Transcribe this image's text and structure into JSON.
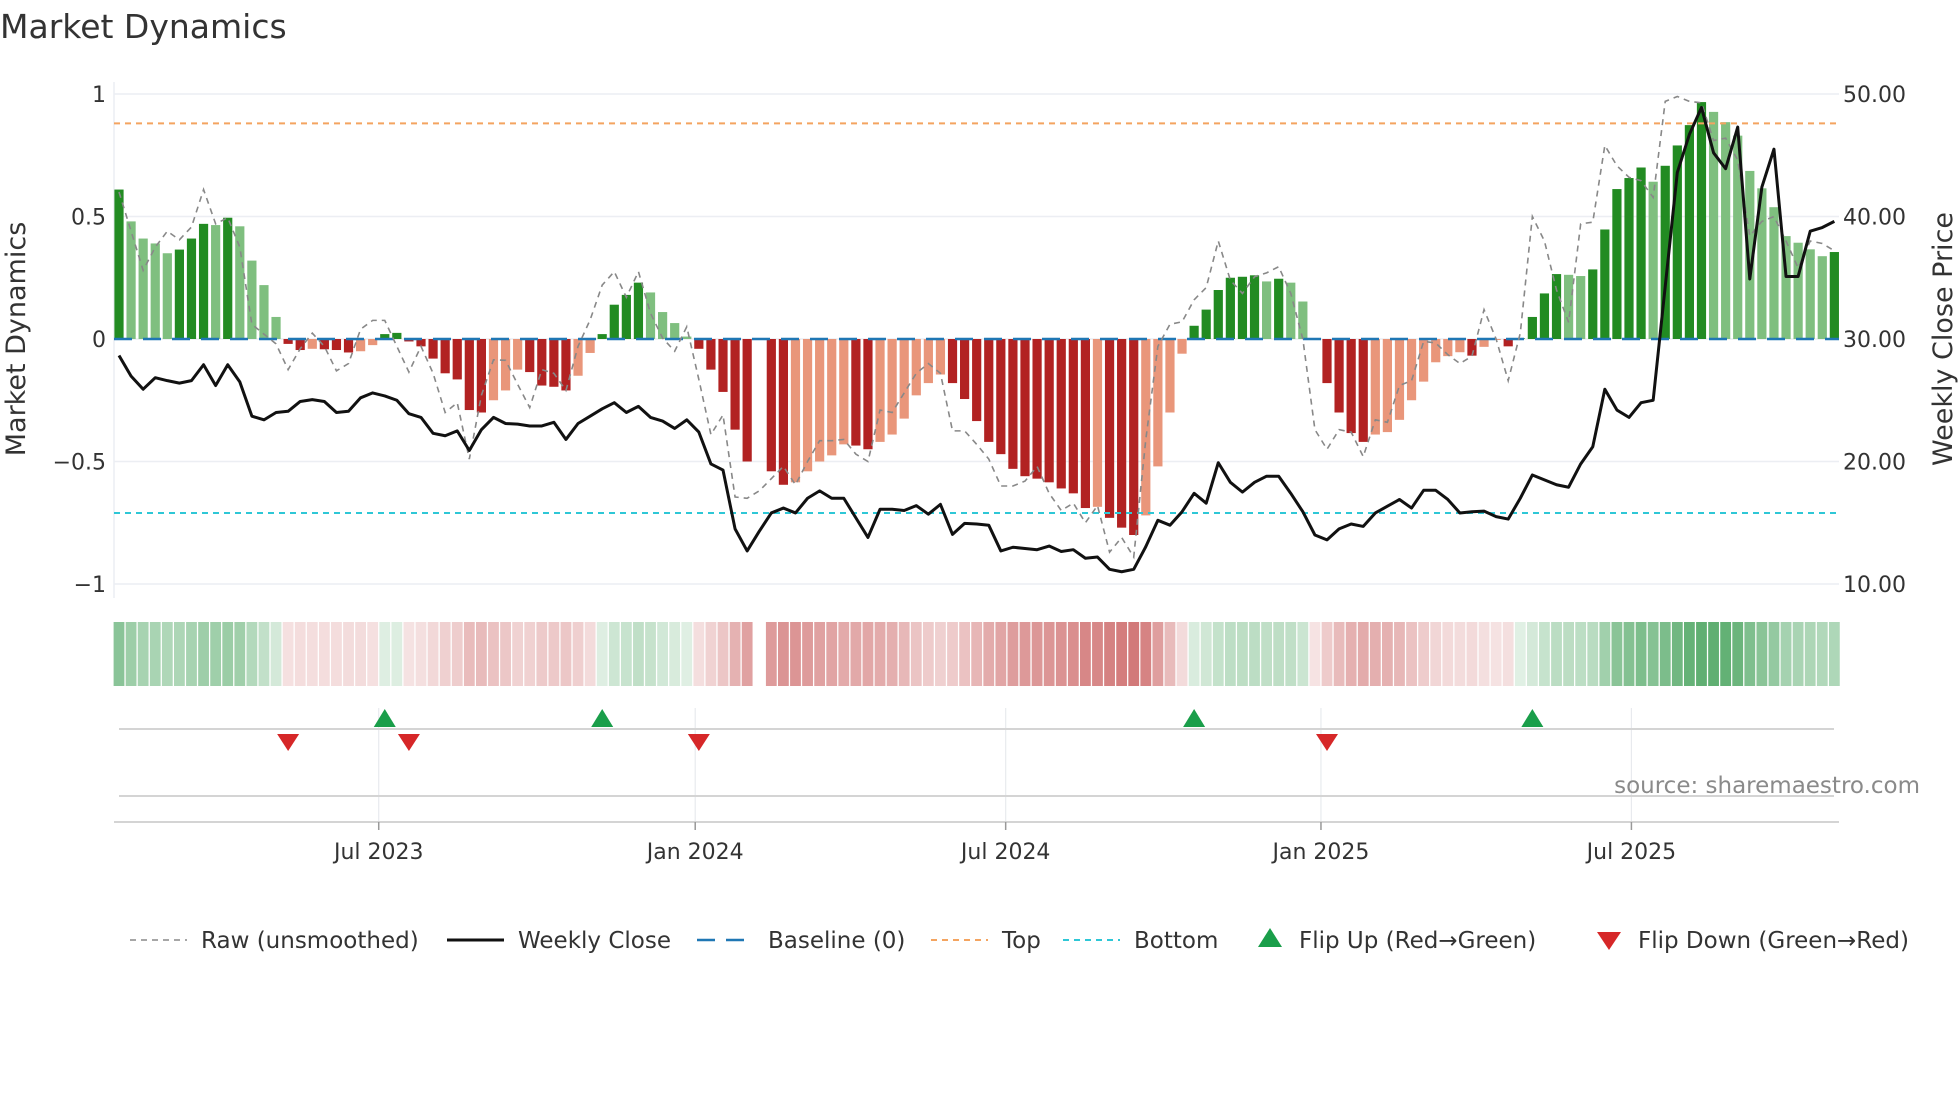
{
  "chart_data": {
    "type": "bar",
    "title": "Market Dynamics",
    "ylabel_left": "Market Dynamics",
    "ylabel_right": "Weekly Close Price",
    "ylim_left": [
      -1,
      1
    ],
    "ylim_right": [
      10,
      50
    ],
    "yticks_left": [
      "1",
      "0.5",
      "0",
      "−0.5",
      "−1"
    ],
    "yticks_left_values": [
      1,
      0.5,
      0,
      -0.5,
      -1
    ],
    "yticks_right": [
      "50.00",
      "40.00",
      "30.00",
      "20.00",
      "10.00"
    ],
    "yticks_right_values": [
      50,
      40,
      30,
      20,
      10
    ],
    "xticks": [
      {
        "label": "Jul 2023",
        "week_index": 21.5
      },
      {
        "label": "Jan 2024",
        "week_index": 47.7
      },
      {
        "label": "Jul 2024",
        "week_index": 73.4
      },
      {
        "label": "Jan 2025",
        "week_index": 99.5
      },
      {
        "label": "Jul 2025",
        "week_index": 125.2
      }
    ],
    "top_level": 0.88,
    "bottom_level": -0.71,
    "baseline": 0,
    "grid": true,
    "smoothed": [
      0.61,
      0.48,
      0.41,
      0.39,
      0.35,
      0.365,
      0.41,
      0.47,
      0.465,
      0.495,
      0.46,
      0.32,
      0.22,
      0.09,
      -0.02,
      -0.045,
      -0.04,
      -0.042,
      -0.045,
      -0.055,
      -0.05,
      -0.025,
      0.02,
      0.025,
      -0.01,
      -0.03,
      -0.08,
      -0.14,
      -0.165,
      -0.29,
      -0.3,
      -0.25,
      -0.21,
      -0.125,
      -0.135,
      -0.19,
      -0.195,
      -0.21,
      -0.15,
      -0.057,
      0.02,
      0.14,
      0.18,
      0.23,
      0.19,
      0.11,
      0.065,
      0.01,
      -0.04,
      -0.125,
      -0.216,
      -0.37,
      -0.5,
      null,
      -0.54,
      -0.595,
      -0.585,
      -0.54,
      -0.5,
      -0.475,
      -0.43,
      -0.435,
      -0.45,
      -0.42,
      -0.39,
      -0.325,
      -0.23,
      -0.18,
      -0.145,
      -0.18,
      -0.245,
      -0.335,
      -0.42,
      -0.47,
      -0.53,
      -0.56,
      -0.57,
      -0.585,
      -0.61,
      -0.63,
      -0.69,
      -0.685,
      -0.73,
      -0.77,
      -0.8,
      -0.72,
      -0.52,
      -0.3,
      -0.06,
      0.054,
      0.12,
      0.2,
      0.25,
      0.254,
      0.26,
      0.235,
      0.246,
      0.23,
      0.153,
      -0.003,
      -0.18,
      -0.3,
      -0.384,
      -0.42,
      -0.39,
      -0.38,
      -0.33,
      -0.25,
      -0.174,
      -0.095,
      -0.07,
      -0.054,
      -0.068,
      -0.032,
      -0.004,
      -0.03,
      0.003,
      0.09,
      0.186,
      0.265,
      0.262,
      0.257,
      0.284,
      0.447,
      0.612,
      0.657,
      0.7,
      0.642,
      0.707,
      0.79,
      0.873,
      0.967,
      0.927,
      0.885,
      0.83,
      0.686,
      0.615,
      0.538,
      0.42,
      0.393,
      0.366,
      0.338,
      0.355
    ],
    "raw": [
      0.6,
      0.44,
      0.28,
      0.375,
      0.44,
      0.405,
      0.457,
      0.61,
      0.47,
      0.495,
      0.375,
      0.06,
      0.02,
      -0.02,
      -0.125,
      -0.04,
      0.024,
      -0.03,
      -0.13,
      -0.1,
      0.04,
      0.076,
      0.076,
      -0.03,
      -0.135,
      -0.03,
      -0.14,
      -0.3,
      -0.26,
      -0.49,
      -0.23,
      -0.085,
      -0.087,
      -0.185,
      -0.28,
      -0.125,
      -0.14,
      -0.21,
      -0.03,
      0.078,
      0.22,
      0.275,
      0.17,
      0.275,
      0.105,
      0.004,
      -0.05,
      0.05,
      -0.165,
      -0.39,
      -0.31,
      -0.645,
      -0.65,
      -0.62,
      -0.57,
      -0.52,
      -0.595,
      -0.5,
      -0.415,
      -0.415,
      -0.41,
      -0.47,
      -0.5,
      -0.29,
      -0.3,
      -0.22,
      -0.14,
      -0.1,
      -0.14,
      -0.375,
      -0.375,
      -0.43,
      -0.49,
      -0.6,
      -0.6,
      -0.58,
      -0.52,
      -0.63,
      -0.7,
      -0.67,
      -0.75,
      -0.68,
      -0.87,
      -0.81,
      -0.89,
      -0.41,
      -0.03,
      0.06,
      0.07,
      0.16,
      0.21,
      0.4,
      0.24,
      0.186,
      0.254,
      0.27,
      0.295,
      0.186,
      0.0,
      -0.37,
      -0.45,
      -0.37,
      -0.38,
      -0.48,
      -0.33,
      -0.34,
      -0.19,
      -0.17,
      -0.01,
      -0.016,
      -0.064,
      -0.1,
      -0.07,
      0.12,
      0.0,
      -0.17,
      0.024,
      0.5,
      0.4,
      0.2,
      0.068,
      0.47,
      0.477,
      0.79,
      0.707,
      0.66,
      0.646,
      0.578,
      0.97,
      0.99,
      0.97,
      0.964,
      0.81,
      0.82,
      0.73,
      0.42,
      0.48,
      0.5,
      0.4,
      0.29,
      0.4,
      0.39,
      0.36
    ],
    "close": [
      28.65,
      26.97,
      25.9,
      26.84,
      26.6,
      26.4,
      26.6,
      27.9,
      26.2,
      27.9,
      26.5,
      23.7,
      23.4,
      24.0,
      24.1,
      24.9,
      25.05,
      24.9,
      24.0,
      24.1,
      25.2,
      25.6,
      25.35,
      25.0,
      23.9,
      23.6,
      22.3,
      22.1,
      22.5,
      20.9,
      22.6,
      23.6,
      23.1,
      23.05,
      22.9,
      22.9,
      23.2,
      21.8,
      23.1,
      23.7,
      24.3,
      24.8,
      24.0,
      24.5,
      23.6,
      23.3,
      22.7,
      23.4,
      22.4,
      19.8,
      19.3,
      14.5,
      12.7,
      14.3,
      15.8,
      16.2,
      15.8,
      17.0,
      17.6,
      17.0,
      17.0,
      15.4,
      13.8,
      16.1,
      16.1,
      16.0,
      16.4,
      15.7,
      16.5,
      14.05,
      14.95,
      14.9,
      14.8,
      12.7,
      13.0,
      12.9,
      12.8,
      13.1,
      12.65,
      12.8,
      12.1,
      12.2,
      11.2,
      11.0,
      11.2,
      13.05,
      15.2,
      14.8,
      15.9,
      17.4,
      16.6,
      19.9,
      18.3,
      17.5,
      18.3,
      18.8,
      18.8,
      17.4,
      15.9,
      14.0,
      13.6,
      14.5,
      14.9,
      14.7,
      15.8,
      16.35,
      16.9,
      16.2,
      17.65,
      17.65,
      16.9,
      15.8,
      15.9,
      15.95,
      15.5,
      15.3,
      17.0,
      18.9,
      18.5,
      18.1,
      17.9,
      19.8,
      21.2,
      25.9,
      24.2,
      23.6,
      24.8,
      25.0,
      34.3,
      43.6,
      46.7,
      48.9,
      45.2,
      43.9,
      47.3,
      34.9,
      42.4,
      45.5,
      35.1,
      35.1,
      38.8,
      39.1,
      39.6
    ],
    "flip_up_indices": [
      22,
      40,
      89,
      117
    ],
    "flip_down_indices": [
      14,
      24,
      48,
      100
    ],
    "legend": [
      {
        "label": "Raw (unsmoothed)",
        "kind": "raw"
      },
      {
        "label": "Weekly Close",
        "kind": "close"
      },
      {
        "label": "Baseline (0)",
        "kind": "baseline"
      },
      {
        "label": "Top",
        "kind": "top"
      },
      {
        "label": "Bottom",
        "kind": "bottom"
      },
      {
        "label": "Flip Up (Red→Green)",
        "kind": "up"
      },
      {
        "label": "Flip Down (Green→Red)",
        "kind": "down"
      }
    ],
    "legend_position": "bottom",
    "source": "source: sharemaestro.com",
    "colors": {
      "pos_strong": "#228b22",
      "pos_weak": "#7fbf7f",
      "neg_strong": "#b22222",
      "neg_weak": "#e9967a",
      "close": "#111111",
      "raw": "#888888",
      "baseline": "#1f77b4",
      "top": "#f4a460",
      "bottom": "#2ec7d6",
      "flip_up": "#1a9e4a",
      "flip_down": "#d62728"
    }
  }
}
